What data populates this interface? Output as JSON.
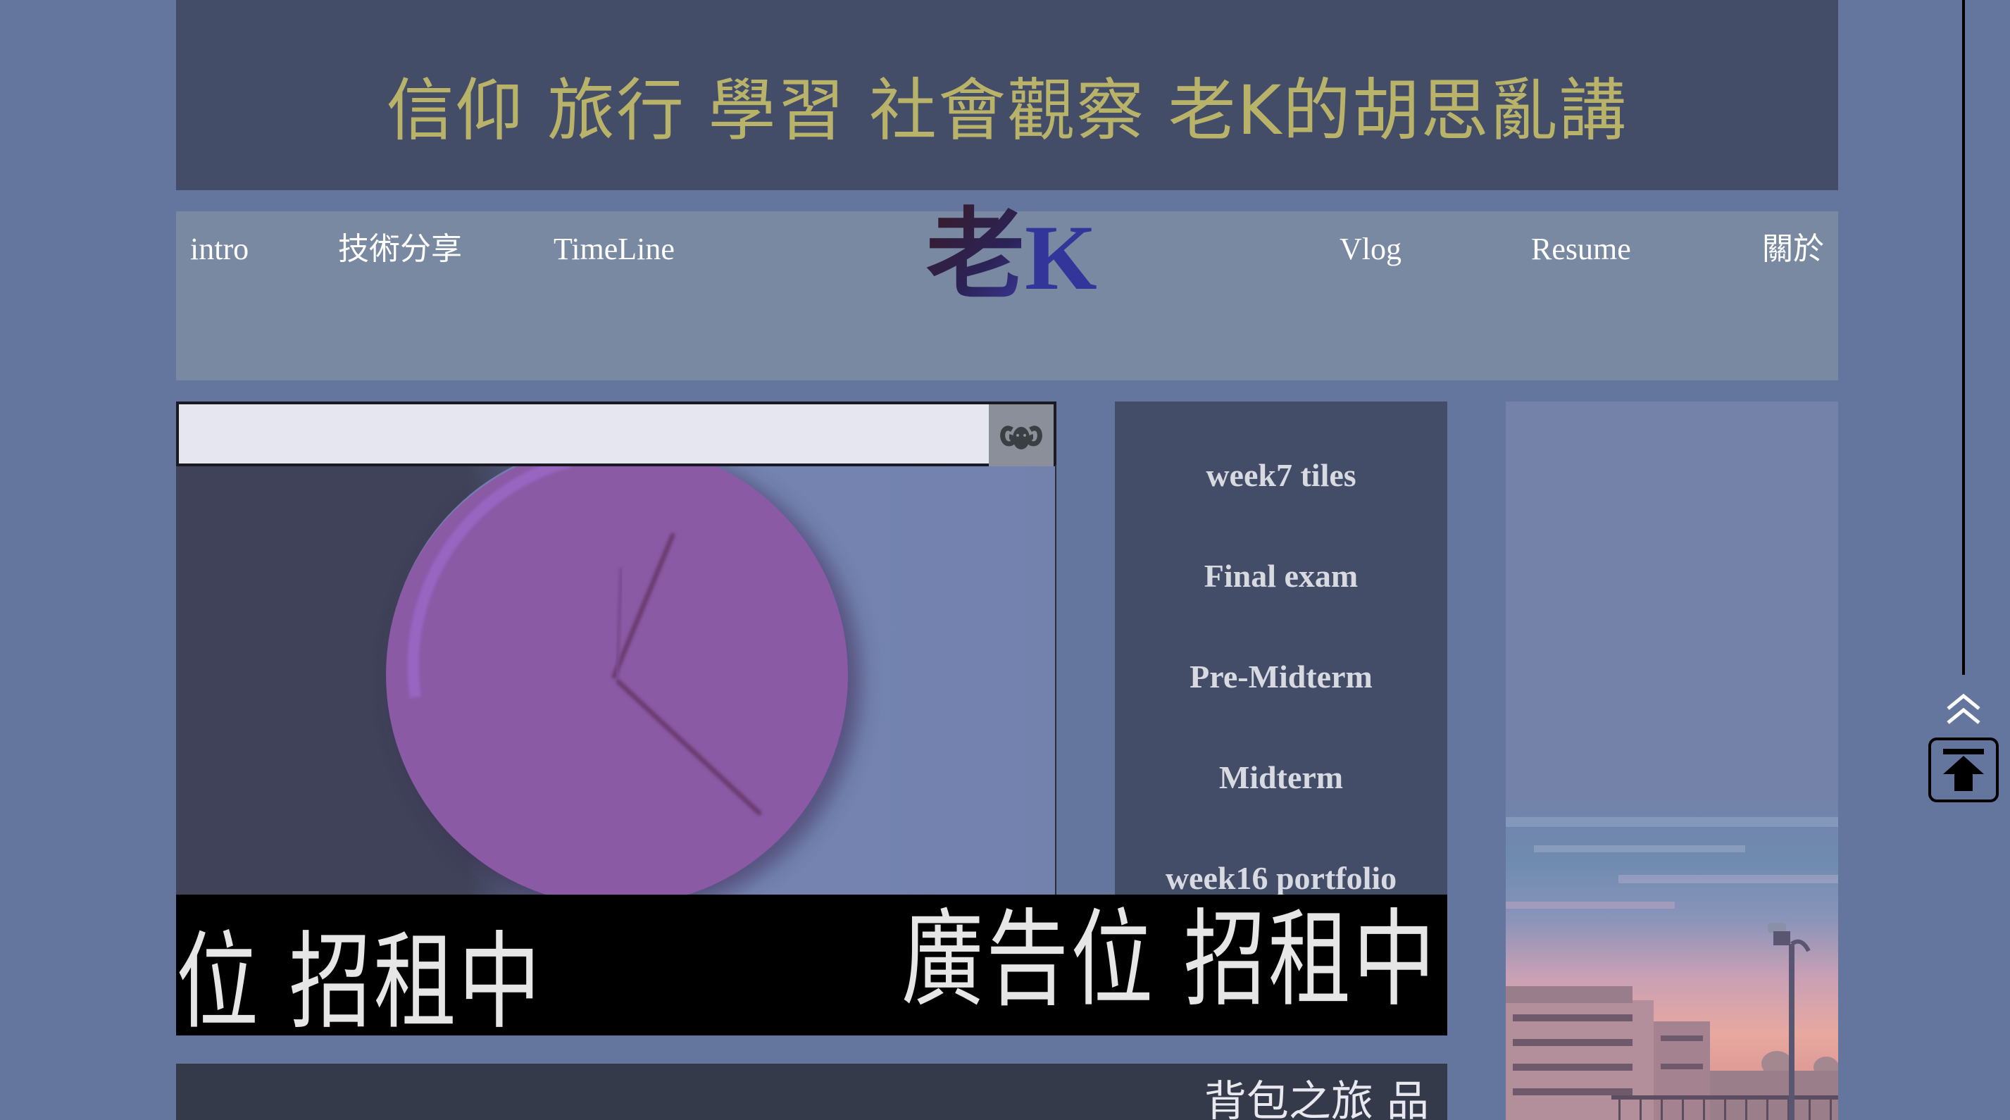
{
  "banner": {
    "title": "信仰 旅行 學習 社會觀察 老K的胡思亂講"
  },
  "nav": {
    "left_items": [
      "intro",
      "技術分享",
      "TimeLine"
    ],
    "logo_cjk": "老",
    "logo_latin": "K",
    "right_items": [
      "Vlog",
      "Resume",
      "關於"
    ]
  },
  "clock": {
    "icon": "ram-icon"
  },
  "posts": {
    "items": [
      "week7 tiles",
      "Final exam",
      "Pre-Midterm",
      "Midterm",
      "week16 portfolio"
    ]
  },
  "ad": {
    "left_text": "位 招租中",
    "right_text": "廣告位 招租中"
  },
  "bottom": {
    "title": "背包之旅 品"
  },
  "back_to_top": {
    "icon": "arrow-up-to-top-icon",
    "chevron_icon": "double-chevron-up-icon"
  },
  "colors": {
    "page_bg": "#64769e",
    "banner_bg": "#434d68",
    "banner_text": "#b9b36a",
    "nav_bg": "#7889a1",
    "clock_face": "#8a5aa5",
    "posts_bg": "#434d68"
  }
}
